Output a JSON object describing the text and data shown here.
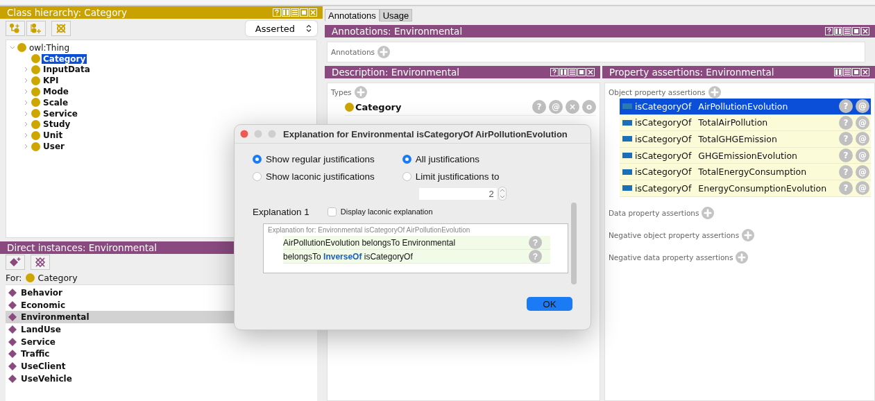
{
  "class_hierarchy": {
    "title": "Class hierarchy: Category",
    "mode": "Asserted",
    "tree": [
      {
        "label": "owl:Thing",
        "kind": "branch",
        "expanded": true,
        "selected": false,
        "children": [
          {
            "label": "Category",
            "kind": "leaf",
            "selected": true
          },
          {
            "label": "InputData",
            "kind": "branch",
            "expanded": false,
            "selected": false
          },
          {
            "label": "KPI",
            "kind": "branch",
            "expanded": false,
            "selected": false
          },
          {
            "label": "Mode",
            "kind": "branch",
            "expanded": false,
            "selected": false
          },
          {
            "label": "Scale",
            "kind": "branch",
            "expanded": false,
            "selected": false
          },
          {
            "label": "Service",
            "kind": "branch",
            "expanded": false,
            "selected": false
          },
          {
            "label": "Study",
            "kind": "branch",
            "expanded": false,
            "selected": false
          },
          {
            "label": "Unit",
            "kind": "branch",
            "expanded": false,
            "selected": false
          },
          {
            "label": "User",
            "kind": "branch",
            "expanded": false,
            "selected": false
          }
        ]
      }
    ]
  },
  "direct_instances": {
    "title": "Direct instances: Environmental",
    "for_label": "For:",
    "for_class": "Category",
    "items": [
      {
        "label": "Behavior",
        "selected": false
      },
      {
        "label": "Economic",
        "selected": false
      },
      {
        "label": "Environmental",
        "selected": true
      },
      {
        "label": "LandUse",
        "selected": false
      },
      {
        "label": "Service",
        "selected": false
      },
      {
        "label": "Traffic",
        "selected": false
      },
      {
        "label": "UseClient",
        "selected": false
      },
      {
        "label": "UseVehicle",
        "selected": false
      }
    ]
  },
  "tabs": [
    {
      "label": "Annotations",
      "selected": true
    },
    {
      "label": "Usage",
      "selected": false
    }
  ],
  "annotations": {
    "title": "Annotations: Environmental",
    "section": "Annotations"
  },
  "description": {
    "title": "Description: Environmental",
    "section": "Types",
    "types": [
      {
        "label": "Category",
        "actions": [
          "?",
          "@",
          "×",
          "o"
        ]
      }
    ]
  },
  "property_assertions": {
    "title": "Property assertions: Environmental",
    "sections": [
      {
        "label": "Object property assertions",
        "rows": [
          {
            "property": "isCategoryOf",
            "value": "AirPollutionEvolution",
            "selected": true,
            "actions": [
              "?",
              "@"
            ]
          },
          {
            "property": "isCategoryOf",
            "value": "TotalAirPollution",
            "selected": false,
            "actions": [
              "?",
              "@"
            ]
          },
          {
            "property": "isCategoryOf",
            "value": "TotalGHGEmission",
            "selected": false,
            "actions": [
              "?",
              "@"
            ]
          },
          {
            "property": "isCategoryOf",
            "value": "GHGEmissionEvolution",
            "selected": false,
            "actions": [
              "?",
              "@"
            ]
          },
          {
            "property": "isCategoryOf",
            "value": "TotalEnergyConsumption",
            "selected": false,
            "actions": [
              "?",
              "@"
            ]
          },
          {
            "property": "isCategoryOf",
            "value": "EnergyConsumptionEvolution",
            "selected": false,
            "actions": [
              "?",
              "@"
            ]
          }
        ]
      },
      {
        "label": "Data property assertions"
      },
      {
        "label": "Negative object property assertions"
      },
      {
        "label": "Negative data property assertions"
      }
    ]
  },
  "dialog": {
    "title": "Explanation for Environmental isCategoryOf AirPollutionEvolution",
    "justification_type": [
      {
        "label": "Show regular justifications",
        "selected": true
      },
      {
        "label": "Show laconic justifications",
        "selected": false
      }
    ],
    "justification_limit": [
      {
        "label": "All justifications",
        "selected": true
      },
      {
        "label": "Limit justifications to",
        "selected": false
      }
    ],
    "limit_value": "2",
    "explanation": {
      "heading": "Explanation 1",
      "laconic_option": {
        "label": "Display laconic explanation",
        "checked": false
      },
      "caption": "Explanation for: Environmental isCategoryOf AirPollutionEvolution",
      "axioms": [
        {
          "parts": [
            {
              "text": "AirPollutionEvolution belongsTo Environmental",
              "kind": "plain"
            }
          ],
          "actions": [
            "?"
          ]
        },
        {
          "parts": [
            {
              "text": "belongsTo",
              "kind": "plain"
            },
            {
              "text": "InverseOf",
              "kind": "keyword"
            },
            {
              "text": "isCategoryOf",
              "kind": "plain"
            }
          ],
          "actions": [
            "?"
          ]
        }
      ]
    },
    "ok": "OK"
  }
}
